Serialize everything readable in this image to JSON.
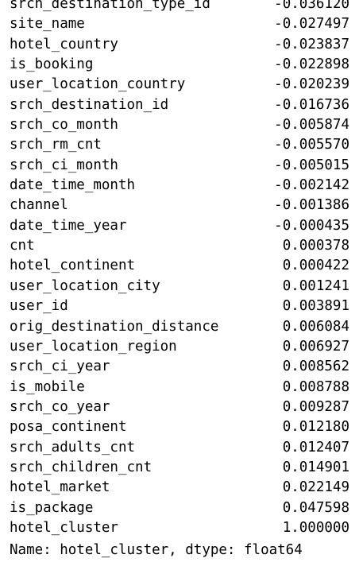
{
  "series": {
    "rows": [
      {
        "name": "srch_destination_type_id",
        "value": "-0.036120"
      },
      {
        "name": "site_name",
        "value": "-0.027497"
      },
      {
        "name": "hotel_country",
        "value": "-0.023837"
      },
      {
        "name": "is_booking",
        "value": "-0.022898"
      },
      {
        "name": "user_location_country",
        "value": "-0.020239"
      },
      {
        "name": "srch_destination_id",
        "value": "-0.016736"
      },
      {
        "name": "srch_co_month",
        "value": "-0.005874"
      },
      {
        "name": "srch_rm_cnt",
        "value": "-0.005570"
      },
      {
        "name": "srch_ci_month",
        "value": "-0.005015"
      },
      {
        "name": "date_time_month",
        "value": "-0.002142"
      },
      {
        "name": "channel",
        "value": "-0.001386"
      },
      {
        "name": "date_time_year",
        "value": "-0.000435"
      },
      {
        "name": "cnt",
        "value": "0.000378"
      },
      {
        "name": "hotel_continent",
        "value": "0.000422"
      },
      {
        "name": "user_location_city",
        "value": "0.001241"
      },
      {
        "name": "user_id",
        "value": "0.003891"
      },
      {
        "name": "orig_destination_distance",
        "value": "0.006084"
      },
      {
        "name": "user_location_region",
        "value": "0.006927"
      },
      {
        "name": "srch_ci_year",
        "value": "0.008562"
      },
      {
        "name": "is_mobile",
        "value": "0.008788"
      },
      {
        "name": "srch_co_year",
        "value": "0.009287"
      },
      {
        "name": "posa_continent",
        "value": "0.012180"
      },
      {
        "name": "srch_adults_cnt",
        "value": "0.012407"
      },
      {
        "name": "srch_children_cnt",
        "value": "0.014901"
      },
      {
        "name": "hotel_market",
        "value": "0.022149"
      },
      {
        "name": "is_package",
        "value": "0.047598"
      },
      {
        "name": "hotel_cluster",
        "value": "1.000000"
      }
    ],
    "footer": "Name: hotel_cluster, dtype: float64"
  }
}
